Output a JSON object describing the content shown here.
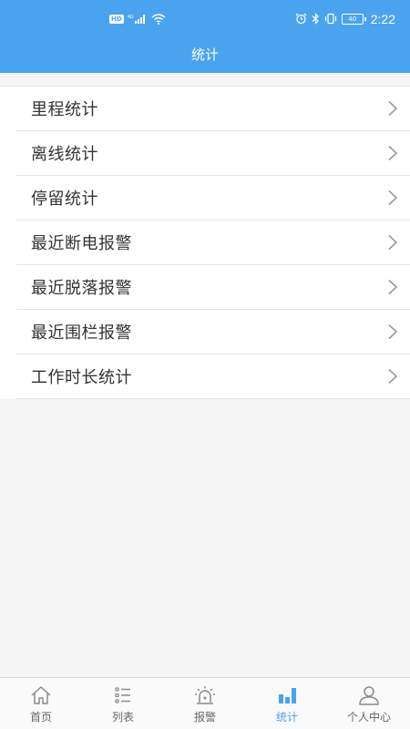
{
  "status_bar": {
    "left_badge": "HD",
    "network_label": "4G",
    "battery_level": "40",
    "time": "2:22"
  },
  "header": {
    "title": "统计"
  },
  "menu": {
    "items": [
      {
        "label": "里程统计"
      },
      {
        "label": "离线统计"
      },
      {
        "label": "停留统计"
      },
      {
        "label": "最近断电报警"
      },
      {
        "label": "最近脱落报警"
      },
      {
        "label": "最近围栏报警"
      },
      {
        "label": "工作时长统计"
      }
    ]
  },
  "bottom_nav": {
    "items": [
      {
        "label": "首页",
        "icon": "home-icon",
        "active": false
      },
      {
        "label": "列表",
        "icon": "list-icon",
        "active": false
      },
      {
        "label": "报警",
        "icon": "alarm-light-icon",
        "active": false
      },
      {
        "label": "统计",
        "icon": "bar-chart-icon",
        "active": true
      },
      {
        "label": "个人中心",
        "icon": "user-icon",
        "active": false
      }
    ]
  },
  "colors": {
    "primary": "#4aa3ee",
    "text": "#333333",
    "nav_inactive": "#666666",
    "background": "#f5f5f5"
  }
}
